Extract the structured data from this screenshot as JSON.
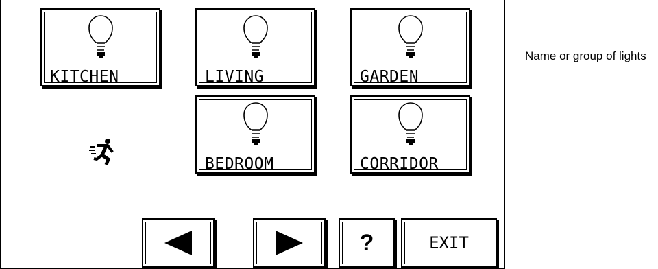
{
  "lights": [
    {
      "label": "KITCHEN",
      "icon": "lightbulb-icon"
    },
    {
      "label": "LIVING",
      "icon": "lightbulb-icon"
    },
    {
      "label": "GARDEN",
      "icon": "lightbulb-icon"
    },
    {
      "label": "BEDROOM",
      "icon": "lightbulb-icon"
    },
    {
      "label": "CORRIDOR",
      "icon": "lightbulb-icon"
    }
  ],
  "status_icon": "running-man-icon",
  "controls": {
    "prev_icon": "left-arrow-icon",
    "next_icon": "right-arrow-icon",
    "help_label": "?",
    "exit_label": "EXIT"
  },
  "annotation": {
    "text": "Name or group of lights"
  }
}
